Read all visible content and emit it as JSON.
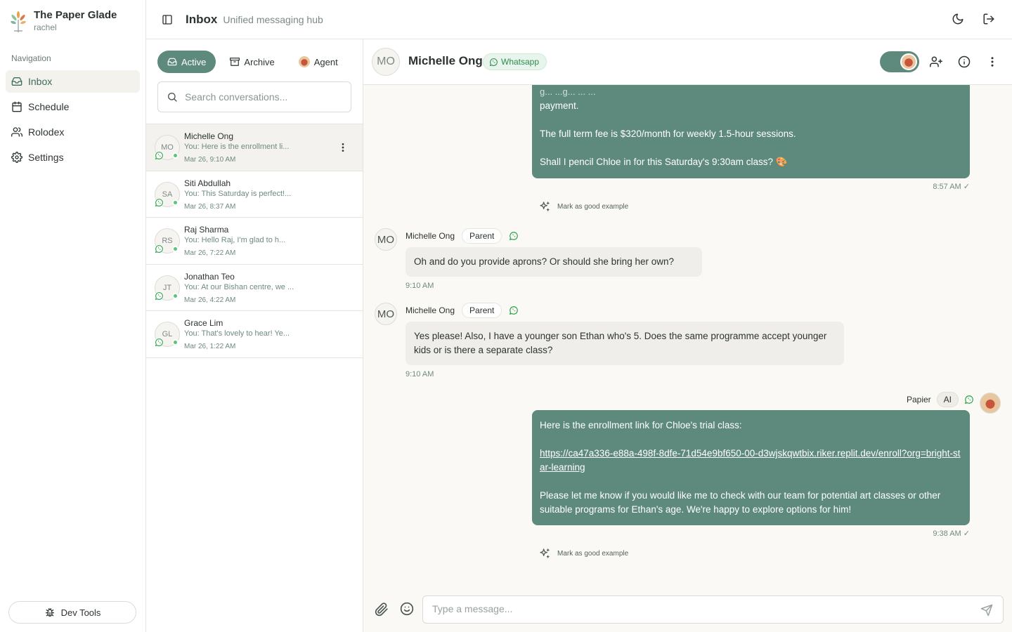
{
  "brand": {
    "name": "The Paper Glade",
    "user": "rachel"
  },
  "nav": {
    "heading": "Navigation",
    "items": [
      {
        "label": "Inbox",
        "icon": "inbox-icon",
        "active": true
      },
      {
        "label": "Schedule",
        "icon": "calendar-icon"
      },
      {
        "label": "Rolodex",
        "icon": "users-icon"
      },
      {
        "label": "Settings",
        "icon": "gear-icon"
      }
    ],
    "dev_tools": "Dev Tools"
  },
  "header": {
    "title": "Inbox",
    "subtitle": "Unified messaging hub"
  },
  "conversations": {
    "tabs": {
      "active": "Active",
      "archive": "Archive",
      "agent": "Agent"
    },
    "search_placeholder": "Search conversations...",
    "items": [
      {
        "initials": "MO",
        "name": "Michelle Ong",
        "preview": "You: Here is the enrollment li...",
        "time": "Mar 26, 9:10 AM"
      },
      {
        "initials": "SA",
        "name": "Siti Abdullah",
        "preview": "You: This Saturday is perfect!...",
        "time": "Mar 26, 8:37 AM"
      },
      {
        "initials": "RS",
        "name": "Raj Sharma",
        "preview": "You: Hello Raj, I'm glad to h...",
        "time": "Mar 26, 7:22 AM"
      },
      {
        "initials": "JT",
        "name": "Jonathan Teo",
        "preview": "You: At our Bishan centre, we ...",
        "time": "Mar 26, 4:22 AM"
      },
      {
        "initials": "GL",
        "name": "Grace Lim",
        "preview": "You: That's lovely to hear! Ye...",
        "time": "Mar 26, 1:22 AM"
      }
    ]
  },
  "chat": {
    "contact_initials": "MO",
    "contact_name": "Michelle Ong",
    "channel": "Whatsapp",
    "msg1": {
      "partial_top": "g... ...g... ... ...",
      "line1": "payment.",
      "line2": "The full term fee is $320/month for weekly 1.5-hour sessions.",
      "line3": "Shall I pencil Chloe in for this Saturday's 9:30am class? 🎨",
      "time": "8:57 AM ✓",
      "mark_good": "Mark as good example"
    },
    "msg2": {
      "initials": "MO",
      "sender": "Michelle Ong",
      "role": "Parent",
      "text": "Oh and do you provide aprons? Or should she bring her own?",
      "time": "9:10 AM"
    },
    "msg3": {
      "initials": "MO",
      "sender": "Michelle Ong",
      "role": "Parent",
      "text": "Yes please! Also, I have a younger son Ethan who's 5. Does the same programme accept younger kids or is there a separate class?",
      "time": "9:10 AM"
    },
    "msg4": {
      "sender": "Papier",
      "badge": "AI",
      "line1": "Here is the enrollment link for Chloe's trial class:",
      "link": "https://ca47a336-e88a-498f-8dfe-71d54e9bf650-00-d3wjskqwtbix.riker.replit.dev/enroll?org=bright-star-learning",
      "line2": "Please let me know if you would like me to check with our team for potential art classes or other suitable programs for Ethan's age. We're happy to explore options for him!",
      "time": "9:38 AM ✓",
      "mark_good": "Mark as good example"
    }
  },
  "composer": {
    "placeholder": "Type a message..."
  },
  "colors": {
    "accent": "#5e8a7d",
    "whatsapp": "#25a244",
    "online": "#5cc474"
  }
}
